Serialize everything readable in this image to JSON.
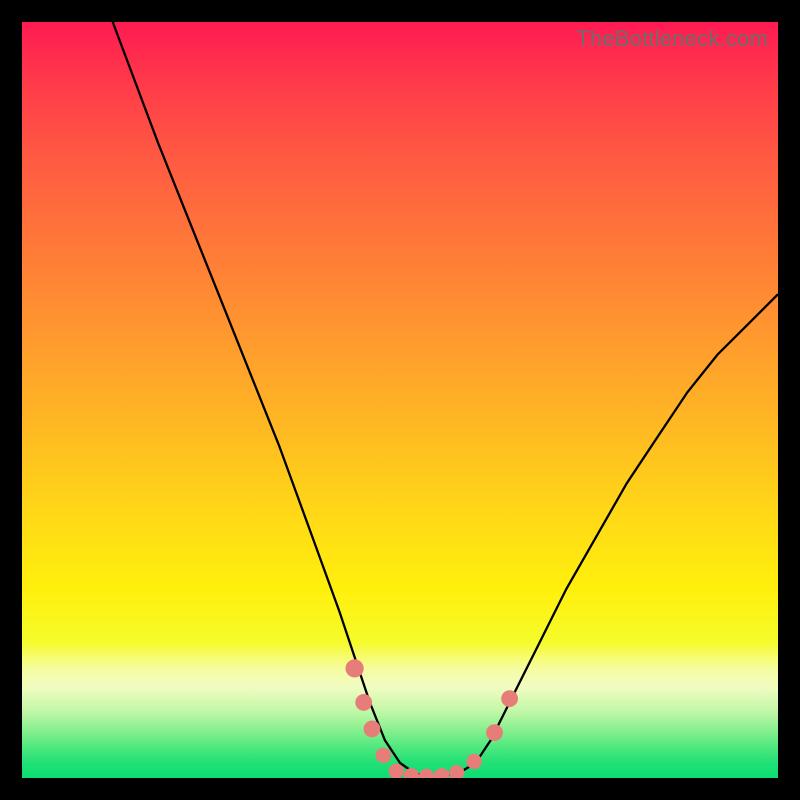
{
  "watermark": "TheBottleneck.com",
  "chart_data": {
    "type": "line",
    "title": "",
    "xlabel": "",
    "ylabel": "",
    "xlim": [
      0,
      100
    ],
    "ylim": [
      0,
      100
    ],
    "series": [
      {
        "name": "curve",
        "x": [
          12,
          15,
          18,
          22,
          26,
          30,
          34,
          38,
          42,
          44,
          46,
          48,
          50,
          52,
          54,
          56,
          58,
          60,
          62,
          64,
          68,
          72,
          76,
          80,
          84,
          88,
          92,
          96,
          100
        ],
        "y": [
          100,
          92,
          84,
          74,
          64,
          54,
          44,
          33,
          22,
          16,
          10,
          5,
          2,
          0.6,
          0.2,
          0.3,
          0.8,
          2,
          5,
          9,
          17,
          25,
          32,
          39,
          45,
          51,
          56,
          60,
          64
        ]
      },
      {
        "name": "markers",
        "points": [
          {
            "x": 44.0,
            "y": 14.5,
            "r": 1.3
          },
          {
            "x": 45.2,
            "y": 10.0,
            "r": 1.2
          },
          {
            "x": 46.3,
            "y": 6.5,
            "r": 1.2
          },
          {
            "x": 47.8,
            "y": 3.0,
            "r": 1.1
          },
          {
            "x": 49.5,
            "y": 0.9,
            "r": 1.1
          },
          {
            "x": 51.5,
            "y": 0.3,
            "r": 1.1
          },
          {
            "x": 53.5,
            "y": 0.2,
            "r": 1.1
          },
          {
            "x": 55.5,
            "y": 0.3,
            "r": 1.1
          },
          {
            "x": 57.5,
            "y": 0.7,
            "r": 1.1
          },
          {
            "x": 59.8,
            "y": 2.2,
            "r": 1.1
          },
          {
            "x": 62.5,
            "y": 6.0,
            "r": 1.2
          },
          {
            "x": 64.5,
            "y": 10.5,
            "r": 1.2
          }
        ]
      }
    ],
    "colors": {
      "curve": "#000000",
      "markers": "#e77d78"
    }
  }
}
